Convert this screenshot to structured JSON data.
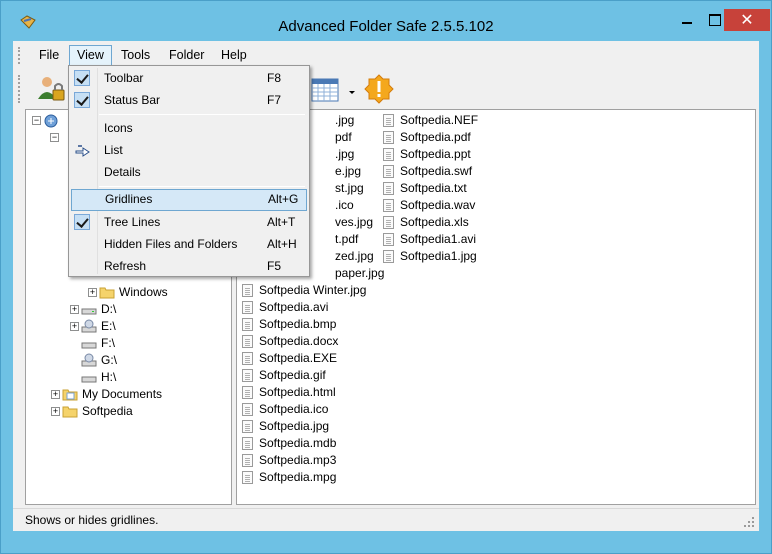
{
  "window": {
    "title": "Advanced Folder Safe 2.5.5.102",
    "close_glyph": "✕"
  },
  "menubar": {
    "items": [
      {
        "label": "File"
      },
      {
        "label": "View"
      },
      {
        "label": "Tools"
      },
      {
        "label": "Folder"
      },
      {
        "label": "Help"
      }
    ]
  },
  "toolbar": {
    "icons": [
      "users-lock-icon",
      "calendar-icon",
      "dropdown-arrow-icon",
      "warning-icon"
    ]
  },
  "view_menu": {
    "items": [
      {
        "label": "Toolbar",
        "shortcut": "F8",
        "checked": true
      },
      {
        "label": "Status Bar",
        "shortcut": "F7",
        "checked": true
      },
      {
        "label": "Icons",
        "shortcut": ""
      },
      {
        "label": "List",
        "shortcut": "",
        "selected_indicator": true
      },
      {
        "label": "Details",
        "shortcut": ""
      },
      {
        "label": "Gridlines",
        "shortcut": "Alt+G",
        "highlighted": true
      },
      {
        "label": "Tree Lines",
        "shortcut": "Alt+T",
        "checked": true
      },
      {
        "label": "Hidden Files and Folders",
        "shortcut": "Alt+H"
      },
      {
        "label": "Refresh",
        "shortcut": "F5"
      }
    ]
  },
  "tree": {
    "visible_nodes": [
      {
        "label": "Windows"
      },
      {
        "label": "D:\\"
      },
      {
        "label": "E:\\"
      },
      {
        "label": "F:\\"
      },
      {
        "label": "G:\\"
      },
      {
        "label": "H:\\"
      },
      {
        "label": "My Documents"
      },
      {
        "label": "Softpedia"
      }
    ]
  },
  "file_list": {
    "column1_partial": [
      ".jpg",
      "pdf",
      ".jpg",
      "e.jpg",
      "st.jpg",
      ".ico",
      "ves.jpg",
      "t.pdf",
      "zed.jpg",
      "paper.jpg"
    ],
    "column1": [
      "Softpedia Winter.jpg",
      "Softpedia.avi",
      "Softpedia.bmp",
      "Softpedia.docx",
      "Softpedia.EXE",
      "Softpedia.gif",
      "Softpedia.html",
      "Softpedia.ico",
      "Softpedia.jpg",
      "Softpedia.mdb",
      "Softpedia.mp3",
      "Softpedia.mpg"
    ],
    "column2": [
      "Softpedia.NEF",
      "Softpedia.pdf",
      "Softpedia.ppt",
      "Softpedia.swf",
      "Softpedia.txt",
      "Softpedia.wav",
      "Softpedia.xls",
      "Softpedia1.avi",
      "Softpedia1.jpg"
    ]
  },
  "statusbar": {
    "text": "Shows or hides gridlines."
  }
}
